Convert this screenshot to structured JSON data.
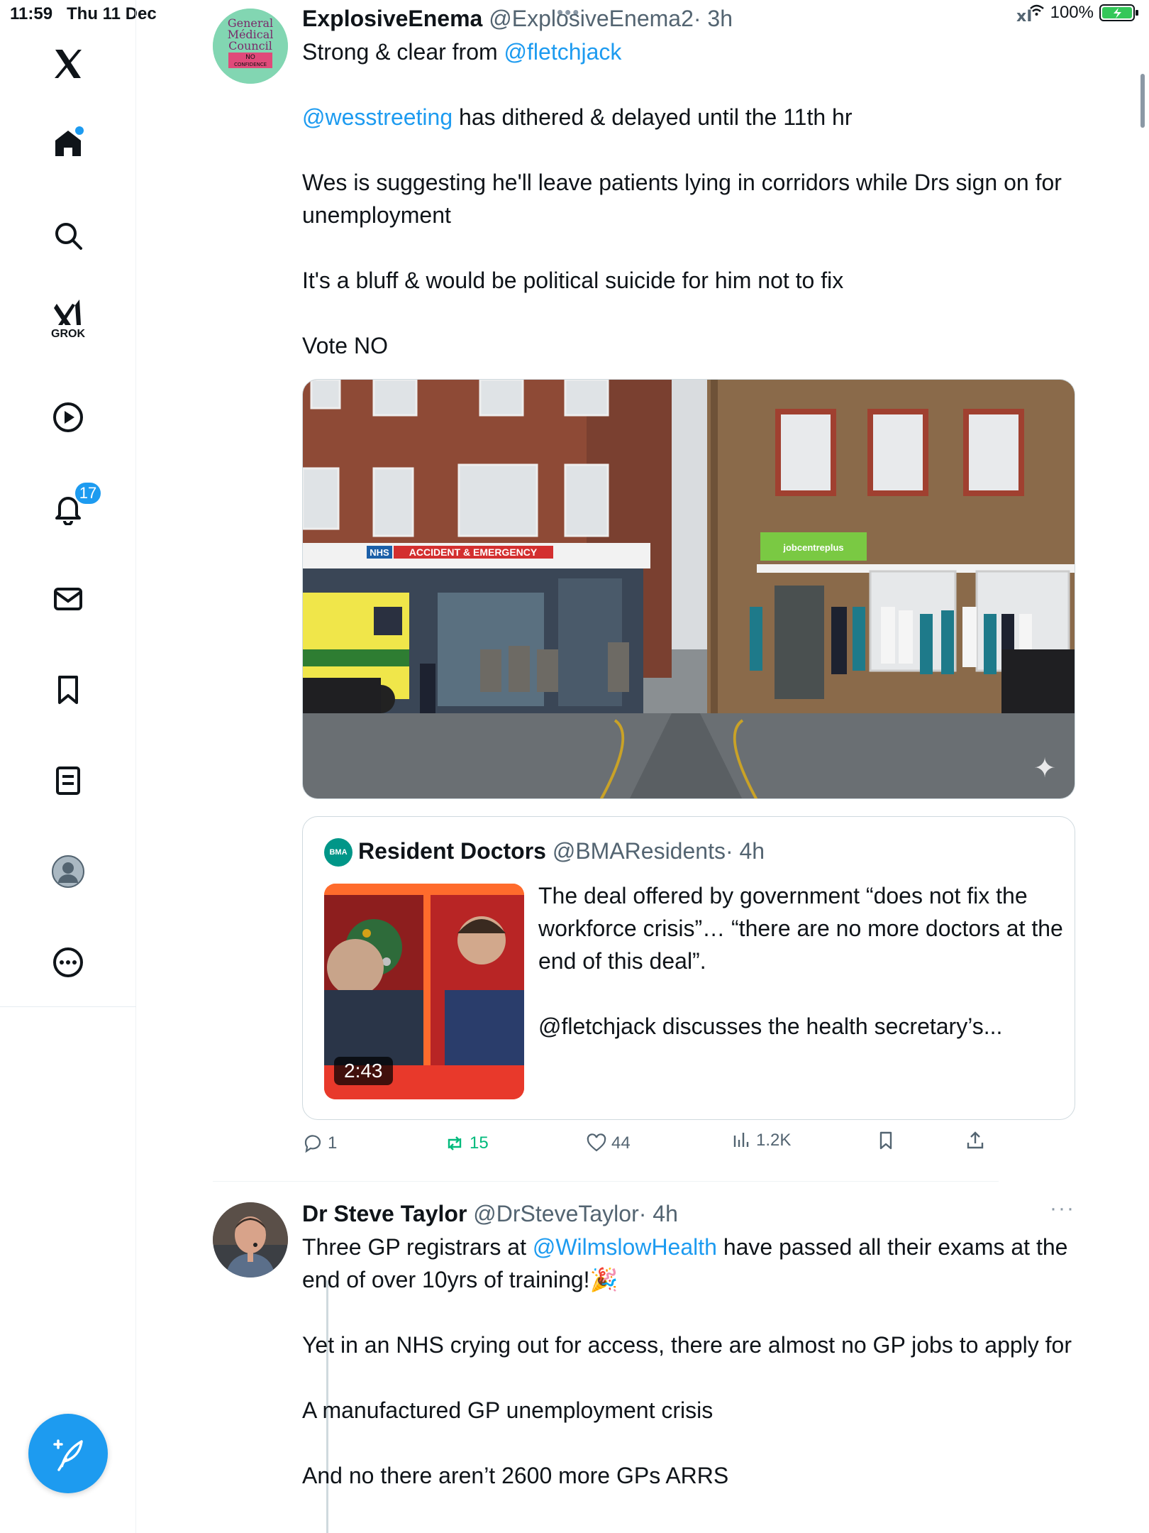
{
  "status_bar": {
    "time": "11:59",
    "date": "Thu 11 Dec",
    "battery_pct": "100%",
    "battery_color": "#34c759"
  },
  "sidebar": {
    "items": [
      {
        "name": "x-logo",
        "icon": "x-logo-icon"
      },
      {
        "name": "home",
        "icon": "home-icon",
        "has_dot": true
      },
      {
        "name": "explore",
        "icon": "search-icon"
      },
      {
        "name": "grok",
        "icon": "grok-icon",
        "label": "GROK"
      },
      {
        "name": "video",
        "icon": "play-icon"
      },
      {
        "name": "notifications",
        "icon": "bell-icon",
        "badge": "17"
      },
      {
        "name": "messages",
        "icon": "envelope-icon"
      },
      {
        "name": "bookmarks",
        "icon": "bookmark-icon"
      },
      {
        "name": "lists",
        "icon": "list-icon"
      },
      {
        "name": "profile",
        "icon": "profile-icon"
      },
      {
        "name": "more",
        "icon": "more-icon"
      }
    ],
    "compose_icon": "feather-plus-icon",
    "accent": "#1d9bf0"
  },
  "posts": [
    {
      "display_name": "ExplosiveEnema",
      "handle": "@ExplosiveEnema2",
      "time": "· 3h",
      "avatar_text": "General Médical Council",
      "avatar_badge": "NO CONFIDENCE",
      "text": {
        "l1_pre": "Strong & clear from ",
        "l1_mention": "@fletchjack",
        "l2_mention": "@wesstreeting",
        "l2_post": " has dithered & delayed until the 11th hr",
        "l3": "Wes is suggesting he'll leave patients lying in corridors while Drs sign on for unemployment",
        "l4": "It's a bluff & would be political suicide for him not to fix",
        "l5": "Vote NO"
      },
      "image_signs": {
        "ae_nhs": "NHS",
        "ae": "ACCIDENT & EMERGENCY",
        "jobcentre": "jobcentreplus"
      },
      "quote": {
        "avatar_text": "BMA",
        "display_name": "Resident Doctors",
        "handle": "@BMAResidents",
        "time": "· 4h",
        "video_duration": "2:43",
        "text_1": "The deal offered by government “does not fix the workforce crisis”… “there are no more doctors at the end of this deal”.",
        "text_2": "@fletchjack discusses the health secretary’s..."
      },
      "actions": {
        "replies": "1",
        "reposts": "15",
        "likes": "44",
        "views": "1.2K"
      }
    },
    {
      "display_name": "Dr Steve Taylor",
      "handle": "@DrSteveTaylor",
      "time": "· 4h",
      "more": "···",
      "text": {
        "l1_pre": "Three GP registrars at ",
        "l1_mention": "@WilmslowHealth",
        "l1_post": " have passed all their exams at the end of over 10yrs of training!🎉",
        "l2": "Yet in an NHS crying out for access, there are almost no GP jobs to apply for",
        "l3": "A manufactured GP unemployment crisis",
        "l4": "And no there aren’t 2600 more GPs ARRS"
      }
    }
  ]
}
